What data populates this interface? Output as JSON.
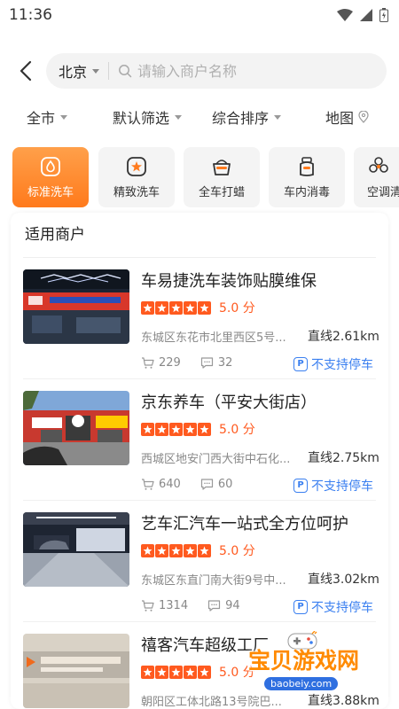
{
  "status_bar": {
    "time": "11:36"
  },
  "search": {
    "city": "北京",
    "placeholder": "请输入商户名称"
  },
  "filters": [
    {
      "label": "全市"
    },
    {
      "label": "默认筛选"
    },
    {
      "label": "综合排序"
    },
    {
      "label": "地图"
    }
  ],
  "categories": [
    {
      "label": "标准洗车",
      "icon": "wash-icon",
      "active": true
    },
    {
      "label": "精致洗车",
      "icon": "star-wash-icon",
      "active": false
    },
    {
      "label": "全车打蜡",
      "icon": "wax-icon",
      "active": false
    },
    {
      "label": "车内消毒",
      "icon": "disinfect-icon",
      "active": false
    },
    {
      "label": "空调清",
      "icon": "ac-clean-icon",
      "active": false
    }
  ],
  "merchants_section": {
    "title": "适用商户"
  },
  "merchants": [
    {
      "name": "车易捷洗车装饰贴膜维保",
      "score": "5.0 分",
      "address": "东城区东花市北里西区5号...",
      "distance": "直线2.61km",
      "orders": "229",
      "comments": "32",
      "parking": "不支持停车"
    },
    {
      "name": "京东养车（平安大街店）",
      "score": "5.0 分",
      "address": "西城区地安门西大街中石化...",
      "distance": "直线2.75km",
      "orders": "640",
      "comments": "60",
      "parking": "不支持停车"
    },
    {
      "name": "艺车汇汽车一站式全方位呵护",
      "score": "5.0 分",
      "address": "东城区东直门南大街9号中...",
      "distance": "直线3.02km",
      "orders": "1314",
      "comments": "94",
      "parking": "不支持停车"
    },
    {
      "name": "禧客汽车超级工厂",
      "score": "5.0 分",
      "address": "朝阳区工体北路13号院巴...",
      "distance": "直线3.88km",
      "orders": "",
      "comments": "",
      "parking": ""
    }
  ],
  "watermark": {
    "title": "宝贝游戏网",
    "url": "baobeiy.com"
  },
  "colors": {
    "accent": "#ff7a1c",
    "rating": "#ff5a1f",
    "link": "#3a7ff0"
  }
}
